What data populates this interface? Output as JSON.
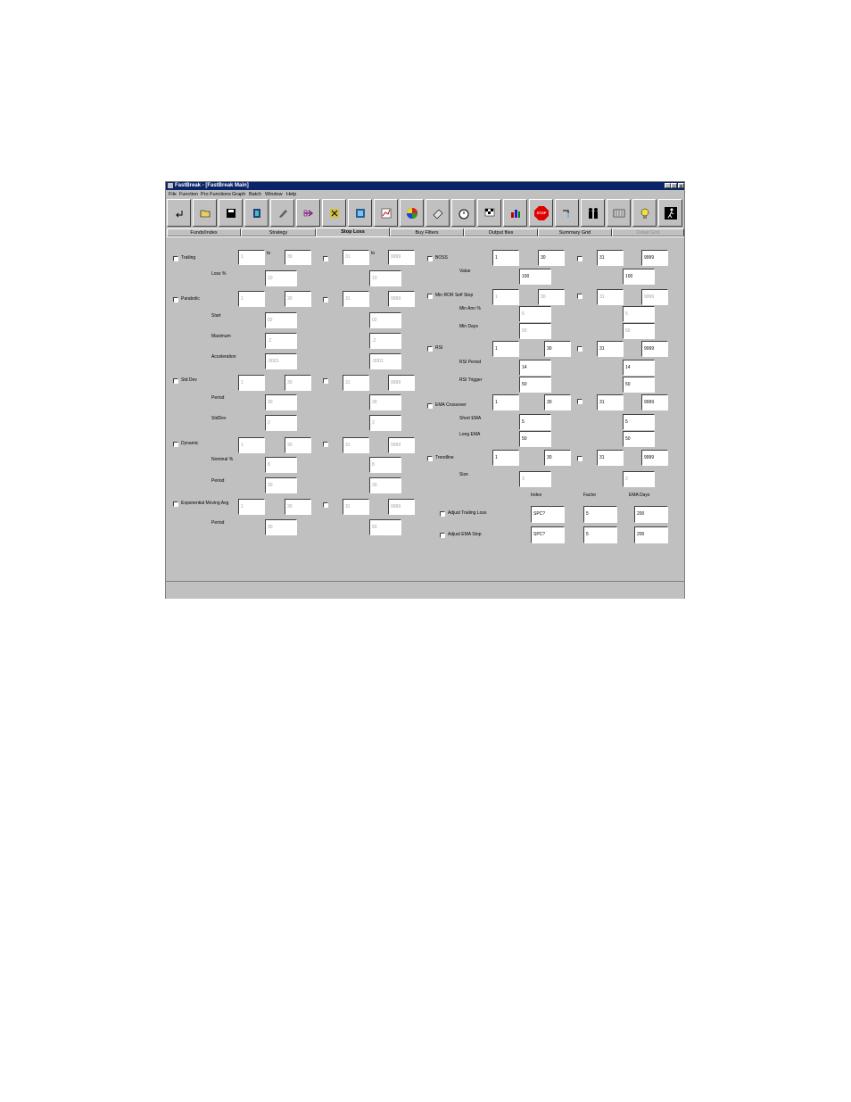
{
  "window": {
    "title": "FastBreak - [FastBreak Main]",
    "min": "_",
    "max": "□",
    "close": "x"
  },
  "menu": [
    "File",
    "Function",
    "Pro Functions",
    "Graph",
    "Batch",
    "Window",
    "Help"
  ],
  "toolbar": [
    "enter-icon",
    "open-folder-icon",
    "save-disk-icon",
    "book-icon",
    "pencil-icon",
    "arrow-icon",
    "puzzle-icon",
    "notebook-icon",
    "chart-icon",
    "color-wheel-icon",
    "eraser-icon",
    "stopwatch-icon",
    "checkered-flag-icon",
    "bar-chart-icon",
    "stop-sign-icon",
    "faucet-icon",
    "people-icon",
    "grid-icon",
    "lightbulb-icon",
    "runner-icon"
  ],
  "stop_label": "STOP",
  "tabs": {
    "funds": "Funds/Index",
    "strategy": "Strategy",
    "stoploss": "Stop Loss",
    "buyfilters": "Buy Filters",
    "output": "Output files",
    "summary": "Summary Grid",
    "detail": "Detail Grid"
  },
  "left": {
    "to": "to",
    "trailing": {
      "label": "Trailing",
      "r1": [
        "1",
        "30",
        "31",
        "9999"
      ],
      "loss_label": "Loss %",
      "loss": [
        "10",
        "10"
      ]
    },
    "parabolic": {
      "label": "Parabolic",
      "r1": [
        "1",
        "30",
        "31",
        "9999"
      ],
      "start_label": "Start",
      "start": [
        "02",
        "02"
      ],
      "max_label": "Maximum",
      "max": [
        ".2",
        ".2"
      ],
      "acc_label": "Acceleration",
      "acc": [
        ".0001",
        ".0001"
      ]
    },
    "stddev": {
      "label": "Std Dev",
      "r1": [
        "1",
        "30",
        "31",
        "9999"
      ],
      "period_label": "Period",
      "period": [
        "30",
        "30"
      ],
      "sd_label": "StdDev",
      "sd": [
        "2",
        "2"
      ]
    },
    "dynamic": {
      "label": "Dynamic",
      "r1": [
        "1",
        "30",
        "31",
        "9999"
      ],
      "nominal_label": "Nominal %",
      "nominal": [
        "8",
        "8"
      ],
      "period_label": "Period",
      "period": [
        "30",
        "30"
      ]
    },
    "ema": {
      "label": "Exponential Moving Avg",
      "r1": [
        "1",
        "30",
        "31",
        "9999"
      ],
      "period_label": "Period",
      "period": [
        "30",
        "50"
      ]
    }
  },
  "right": {
    "boss": {
      "label": "BOSS",
      "r1": [
        "1",
        "30",
        "31",
        "9999"
      ],
      "value_label": "Value",
      "value": [
        "100",
        "100"
      ]
    },
    "minror": {
      "label": "Min ROR Self Stop",
      "r1": [
        "1",
        "30",
        "31",
        "9999"
      ],
      "minann_label": "Min Ann %",
      "minann": [
        "5",
        "5"
      ],
      "mindays_label": "Min Days",
      "mindays": [
        "50",
        "50"
      ]
    },
    "rsi": {
      "label": "RSI",
      "r1": [
        "1",
        "30",
        "31",
        "9999"
      ],
      "period_label": "RSI Period",
      "period": [
        "14",
        "14"
      ],
      "trigger_label": "RSI Trigger",
      "trigger": [
        "50",
        "50"
      ]
    },
    "emax": {
      "label": "EMA Crossover",
      "r1": [
        "1",
        "30",
        "31",
        "9999"
      ],
      "short_label": "Short EMA",
      "short": [
        "5",
        "5"
      ],
      "long_label": "Long EMA",
      "long": [
        "50",
        "50"
      ]
    },
    "trendline": {
      "label": "Trendline",
      "r1": [
        "1",
        "30",
        "31",
        "9999"
      ],
      "size_label": "Size",
      "size": [
        "3",
        "3"
      ]
    },
    "hdr": {
      "index": "Index",
      "factor": "Factor",
      "emadays": "EMA Days"
    },
    "adj_trailing": {
      "label": "Adjust Trailing Loss",
      "index": "SPC?",
      "factor": "5",
      "days": "200"
    },
    "adj_ema": {
      "label": "Adjust EMA Stop",
      "index": "SPC?",
      "factor": "5",
      "days": "200"
    }
  }
}
